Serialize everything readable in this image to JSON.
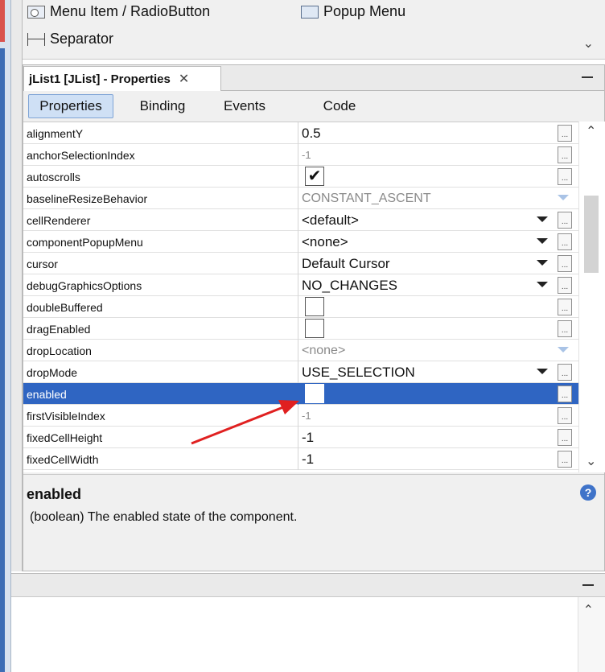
{
  "palette": {
    "items": [
      {
        "label": "Menu Item / RadioButton",
        "icon": "radio-menu-icon"
      },
      {
        "label": "Popup Menu",
        "icon": "popup-menu-icon"
      },
      {
        "label": "Separator",
        "icon": "separator-icon"
      }
    ]
  },
  "panel": {
    "tab_title": "jList1 [JList] - Properties",
    "close_glyph": "✕",
    "subtabs": [
      "Properties",
      "Binding",
      "Events",
      "Code"
    ],
    "active_subtab": "Properties"
  },
  "properties": [
    {
      "name": "alignmentY",
      "value": "0.5",
      "kind": "text"
    },
    {
      "name": "anchorSelectionIndex",
      "value": "-1",
      "kind": "readonly"
    },
    {
      "name": "autoscrolls",
      "value": "true",
      "kind": "checkbox"
    },
    {
      "name": "baselineResizeBehavior",
      "value": "CONSTANT_ASCENT",
      "kind": "readonly-combo"
    },
    {
      "name": "cellRenderer",
      "value": "<default>",
      "kind": "combo"
    },
    {
      "name": "componentPopupMenu",
      "value": "<none>",
      "kind": "combo"
    },
    {
      "name": "cursor",
      "value": "Default Cursor",
      "kind": "combo"
    },
    {
      "name": "debugGraphicsOptions",
      "value": "NO_CHANGES",
      "kind": "combo"
    },
    {
      "name": "doubleBuffered",
      "value": "false",
      "kind": "checkbox"
    },
    {
      "name": "dragEnabled",
      "value": "false",
      "kind": "checkbox"
    },
    {
      "name": "dropLocation",
      "value": "<none>",
      "kind": "readonly-combo"
    },
    {
      "name": "dropMode",
      "value": "USE_SELECTION",
      "kind": "combo"
    },
    {
      "name": "enabled",
      "value": "false",
      "kind": "checkbox",
      "selected": true
    },
    {
      "name": "firstVisibleIndex",
      "value": "-1",
      "kind": "readonly"
    },
    {
      "name": "fixedCellHeight",
      "value": "-1",
      "kind": "text"
    },
    {
      "name": "fixedCellWidth",
      "value": "-1",
      "kind": "text"
    }
  ],
  "description": {
    "title": "enabled",
    "text": "(boolean) The enabled state of the component."
  },
  "colors": {
    "selection": "#2f65c2",
    "annotation_arrow": "#e02020",
    "help_icon": "#3f73c9"
  }
}
